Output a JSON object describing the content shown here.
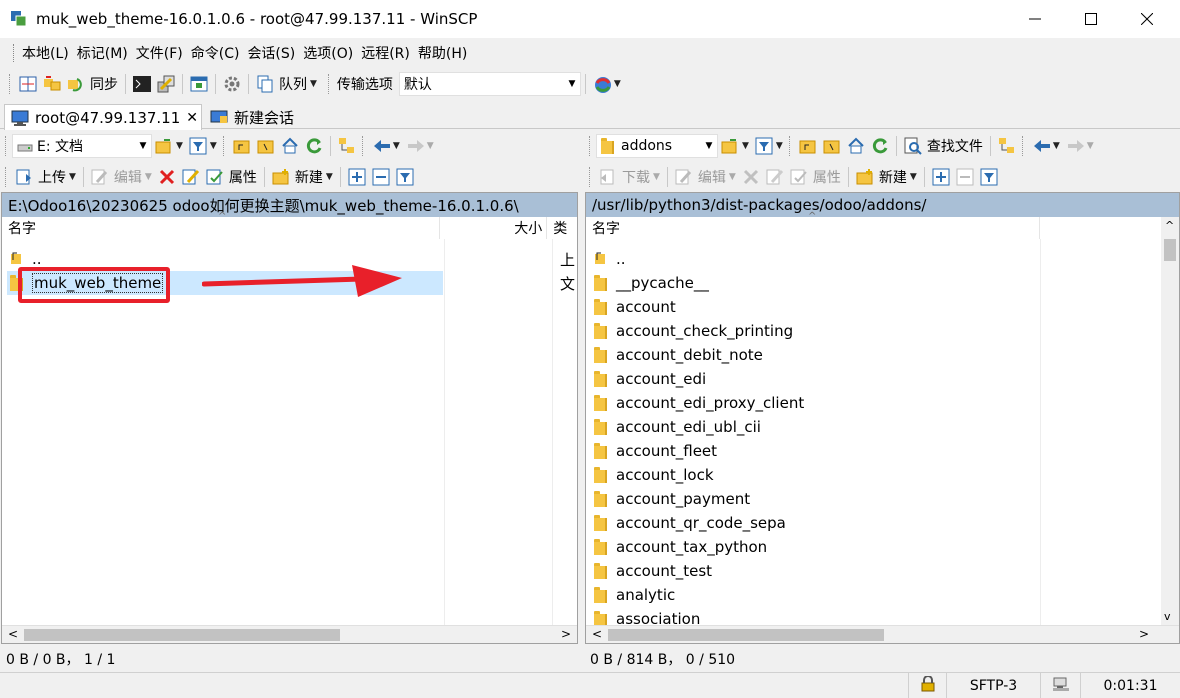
{
  "window": {
    "title": "muk_web_theme-16.0.1.0.6 - root@47.99.137.11 - WinSCP"
  },
  "menu": [
    "本地(L)",
    "标记(M)",
    "文件(F)",
    "命令(C)",
    "会话(S)",
    "选项(O)",
    "远程(R)",
    "帮助(H)"
  ],
  "toolbar": {
    "sync_label": "同步",
    "queue_label": "队列",
    "transfer_options_label": "传输选项",
    "transfer_preset": "默认"
  },
  "tabs": {
    "session_label": "root@47.99.137.11",
    "new_session_label": "新建会话"
  },
  "local": {
    "drive": "E: 文档",
    "upload_label": "上传",
    "edit_label": "编辑",
    "properties_label": "属性",
    "new_label": "新建",
    "path": "E:\\Odoo16\\20230625 odoo如何更换主题\\muk_web_theme-16.0.1.0.6\\",
    "columns": {
      "name": "名字",
      "size": "大小",
      "type": "类"
    },
    "rows": [
      {
        "name": "..",
        "type": "上"
      },
      {
        "name": "muk_web_theme",
        "type": "文"
      }
    ],
    "status": "0 B / 0 B， 1 / 1"
  },
  "remote": {
    "folder": "addons",
    "find_files_label": "查找文件",
    "download_label": "下载",
    "edit_label": "编辑",
    "properties_label": "属性",
    "new_label": "新建",
    "path": "/usr/lib/python3/dist-packages/odoo/addons/",
    "columns": {
      "name": "名字"
    },
    "rows": [
      "..",
      "__pycache__",
      "account",
      "account_check_printing",
      "account_debit_note",
      "account_edi",
      "account_edi_proxy_client",
      "account_edi_ubl_cii",
      "account_fleet",
      "account_lock",
      "account_payment",
      "account_qr_code_sepa",
      "account_tax_python",
      "account_test",
      "analytic",
      "association"
    ],
    "status": "0 B / 814 B， 0 / 510"
  },
  "statusbar": {
    "protocol": "SFTP-3",
    "elapsed": "0:01:31"
  },
  "colors": {
    "path_bar": "#a9bfd6",
    "selection": "#cce8ff",
    "annotation_red": "#e8202a",
    "folder": "#f5c542"
  }
}
